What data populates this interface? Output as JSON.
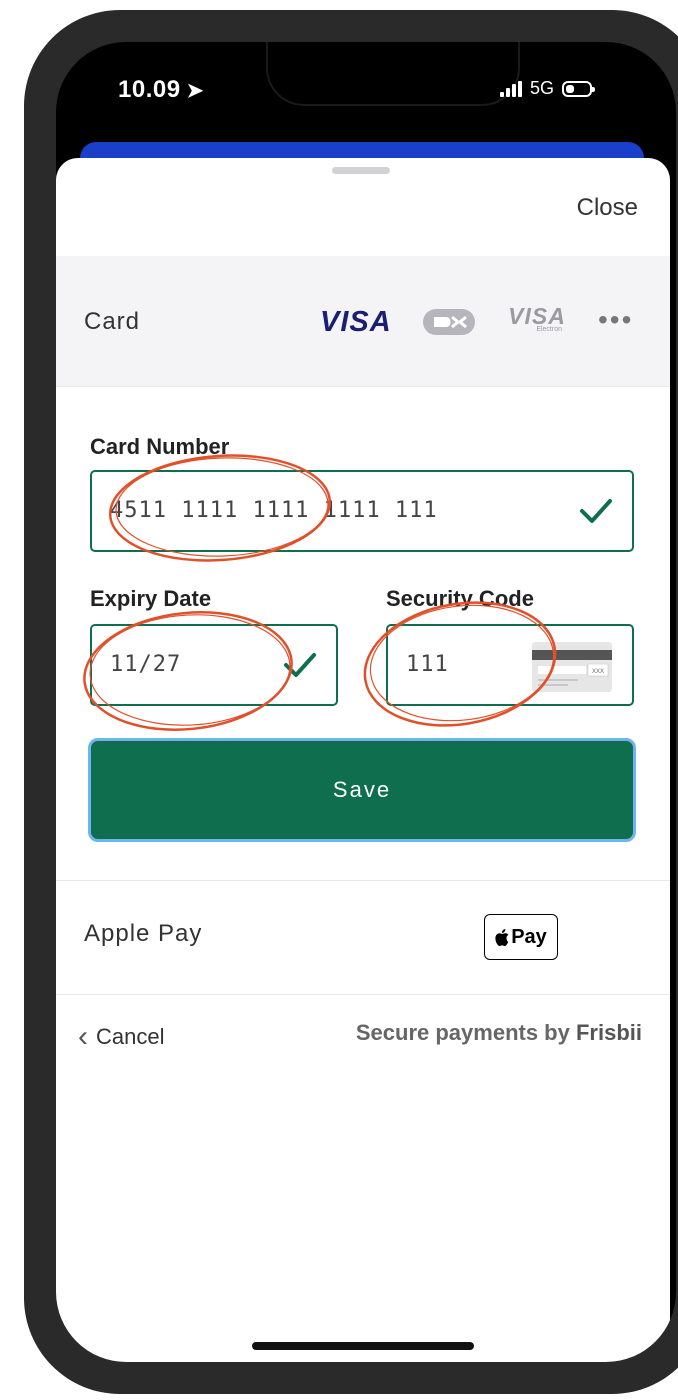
{
  "status_bar": {
    "time": "10.09",
    "network": "5G"
  },
  "sheet": {
    "close_label": "Close",
    "card_method_label": "Card",
    "card_brands": [
      "VISA",
      "Dankort",
      "VISA Electron"
    ],
    "visa_label": "VISA",
    "visa_electron_label": "VISA",
    "visa_electron_sub": "Electron",
    "more_label": "•••"
  },
  "form": {
    "card_number_label": "Card Number",
    "card_number_value": "4511 1111 1111 1111 111",
    "expiry_label": "Expiry Date",
    "expiry_value": "11/27",
    "security_label": "Security Code",
    "security_value": "111",
    "cvc_hint": "XXX",
    "save_label": "Save"
  },
  "apple_pay": {
    "label": "Apple Pay",
    "button_text": "Pay"
  },
  "footer": {
    "cancel_label": "Cancel",
    "secure_text": "Secure payments by",
    "brand": "Frisbii"
  },
  "colors": {
    "accent_green": "#0f6e4d",
    "save_border": "#6fb3ef",
    "annotation_red": "#e0502a",
    "top_strip_blue": "#1a3fc8"
  },
  "icons": [
    "location-arrow-icon",
    "signal-icon",
    "battery-icon",
    "checkmark-icon",
    "cvc-card-icon",
    "chevron-left-icon",
    "apple-logo-icon"
  ]
}
